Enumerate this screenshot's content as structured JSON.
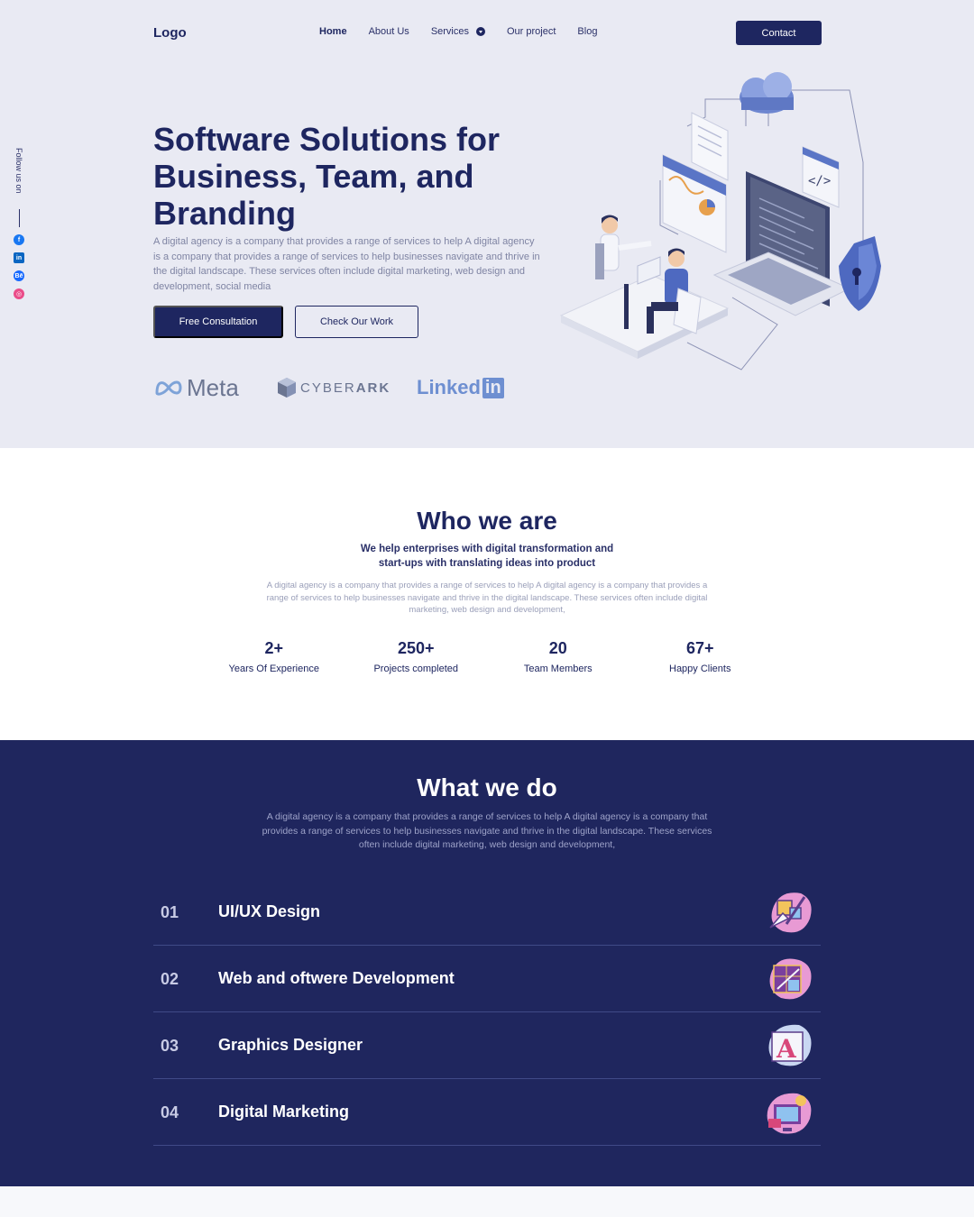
{
  "header": {
    "logo": "Logo",
    "nav": [
      {
        "label": "Home"
      },
      {
        "label": "About Us"
      },
      {
        "label": "Services"
      },
      {
        "label": "Our project"
      },
      {
        "label": "Blog"
      }
    ],
    "contact_label": "Contact"
  },
  "sidebar": {
    "follow_label": "Follow us on",
    "socials": [
      "facebook-icon",
      "linkedin-icon",
      "behance-icon",
      "dribbble-icon"
    ]
  },
  "hero": {
    "title": "Software Solutions for Business, Team, and Branding",
    "description": "A digital agency is a company that provides a range of services to help A digital agency is a company that provides a range of services to help businesses navigate and thrive  in the digital landscape. These services often  include digital marketing, web design and  development, social media",
    "primary_cta": "Free Consultation",
    "secondary_cta": "Check Our Work",
    "brands": {
      "meta": "Meta",
      "cyberark_a": "CYBER",
      "cyberark_b": "ARK",
      "linkedin_a": "Linked",
      "linkedin_b": "in"
    }
  },
  "who": {
    "title": "Who we are",
    "subtitle": "We help enterprises with digital transformation and start-ups with translating ideas into product",
    "description": "A digital agency is a company that provides a range of services to help A digital agency is a company that provides a range of services to help businesses navigate and thrive in the digital landscape. These services often include digital marketing,  web design and  development,",
    "stats": [
      {
        "value": "2+",
        "label": "Years Of Experience"
      },
      {
        "value": "250+",
        "label": "Projects completed"
      },
      {
        "value": "20",
        "label": "Team Members"
      },
      {
        "value": "67+",
        "label": "Happy Clients"
      }
    ]
  },
  "what": {
    "title": "What we do",
    "description": "A digital agency is a company that provides a range of services to help A digital agency is a company that provides a range of services to help businesses navigate and thrive in the digital landscape. These services often include digital marketing,  web design and  development,",
    "services": [
      {
        "num": "01",
        "title": "UI/UX Design",
        "icon": "design-tools-icon"
      },
      {
        "num": "02",
        "title": "Web and oftwere Development",
        "icon": "web-grid-icon"
      },
      {
        "num": "03",
        "title": "Graphics Designer",
        "icon": "typography-icon"
      },
      {
        "num": "04",
        "title": "Digital Marketing",
        "icon": "marketing-icon"
      }
    ]
  },
  "colors": {
    "primary": "#1e2660",
    "hero_bg": "#e9eaf3",
    "dark_section": "#1f265e"
  }
}
